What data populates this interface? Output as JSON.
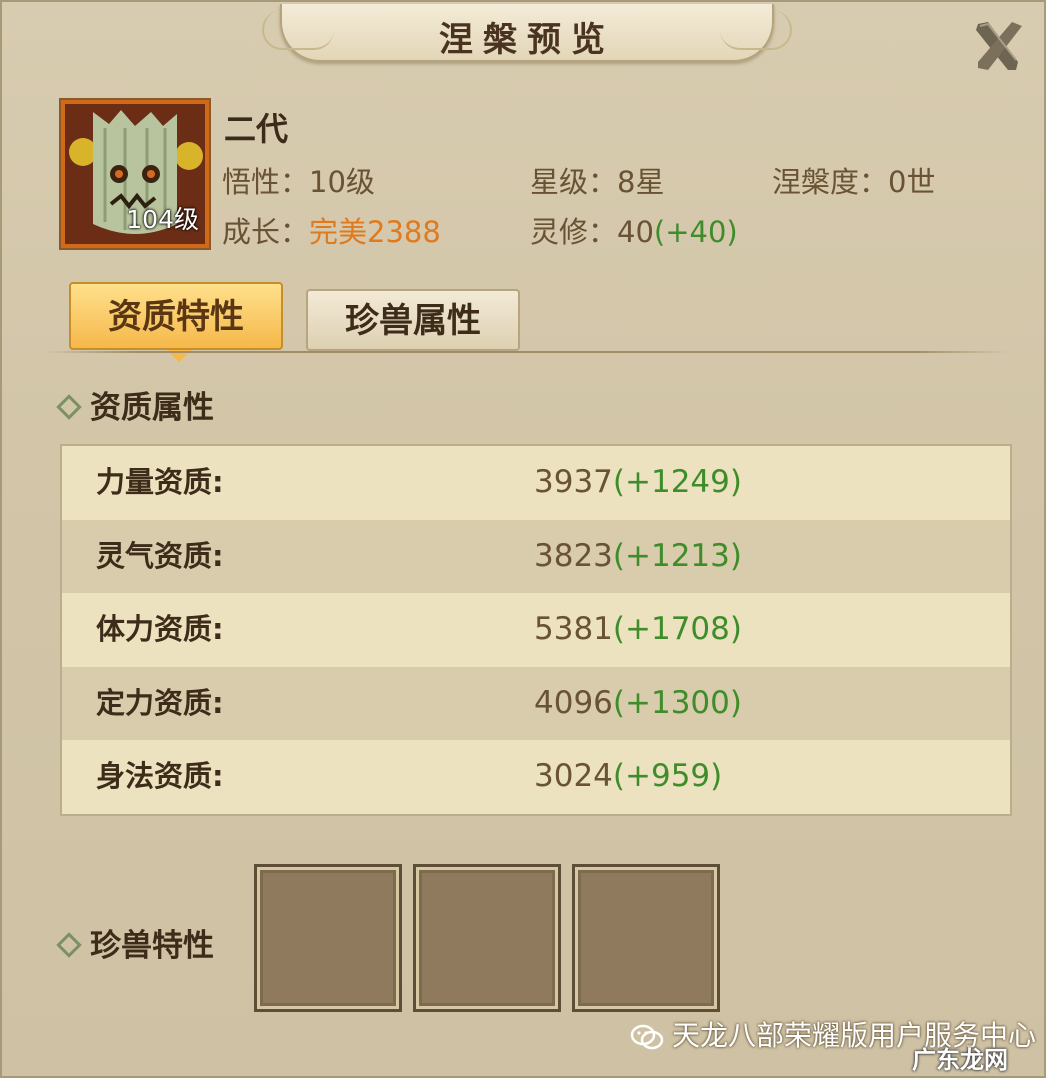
{
  "window": {
    "title": "涅槃预览"
  },
  "pet": {
    "level_badge": "104级",
    "name": "二代",
    "savvy_label": "悟性：",
    "savvy_value": "10级",
    "star_label": "星级：",
    "star_value": "8星",
    "nirvana_label": "涅槃度：",
    "nirvana_value": "0世",
    "growth_label": "成长：",
    "growth_value": "完美2388",
    "spirit_label": "灵修：",
    "spirit_value": "40",
    "spirit_bonus": "(+40)"
  },
  "tabs": [
    {
      "label": "资质特性",
      "active": true
    },
    {
      "label": "珍兽属性",
      "active": false
    }
  ],
  "aptitude": {
    "heading": "资质属性",
    "rows": [
      {
        "label": "力量资质:",
        "value": "3937",
        "bonus": "(+1249)"
      },
      {
        "label": "灵气资质:",
        "value": "3823",
        "bonus": "(+1213)"
      },
      {
        "label": "体力资质:",
        "value": "5381",
        "bonus": "(+1708)"
      },
      {
        "label": "定力资质:",
        "value": "4096",
        "bonus": "(+1300)"
      },
      {
        "label": "身法资质:",
        "value": "3024",
        "bonus": "(+959)"
      }
    ]
  },
  "traits": {
    "heading": "珍兽特性",
    "slots": 3
  },
  "watermark": {
    "text": "天龙八部荣耀版用户服务中心",
    "site": "广东龙网",
    "icon": "wechat-icon"
  },
  "colors": {
    "bonus_green": "#3f8c2a",
    "growth_orange": "#e07a1e",
    "tab_active": "#f5b84a"
  }
}
